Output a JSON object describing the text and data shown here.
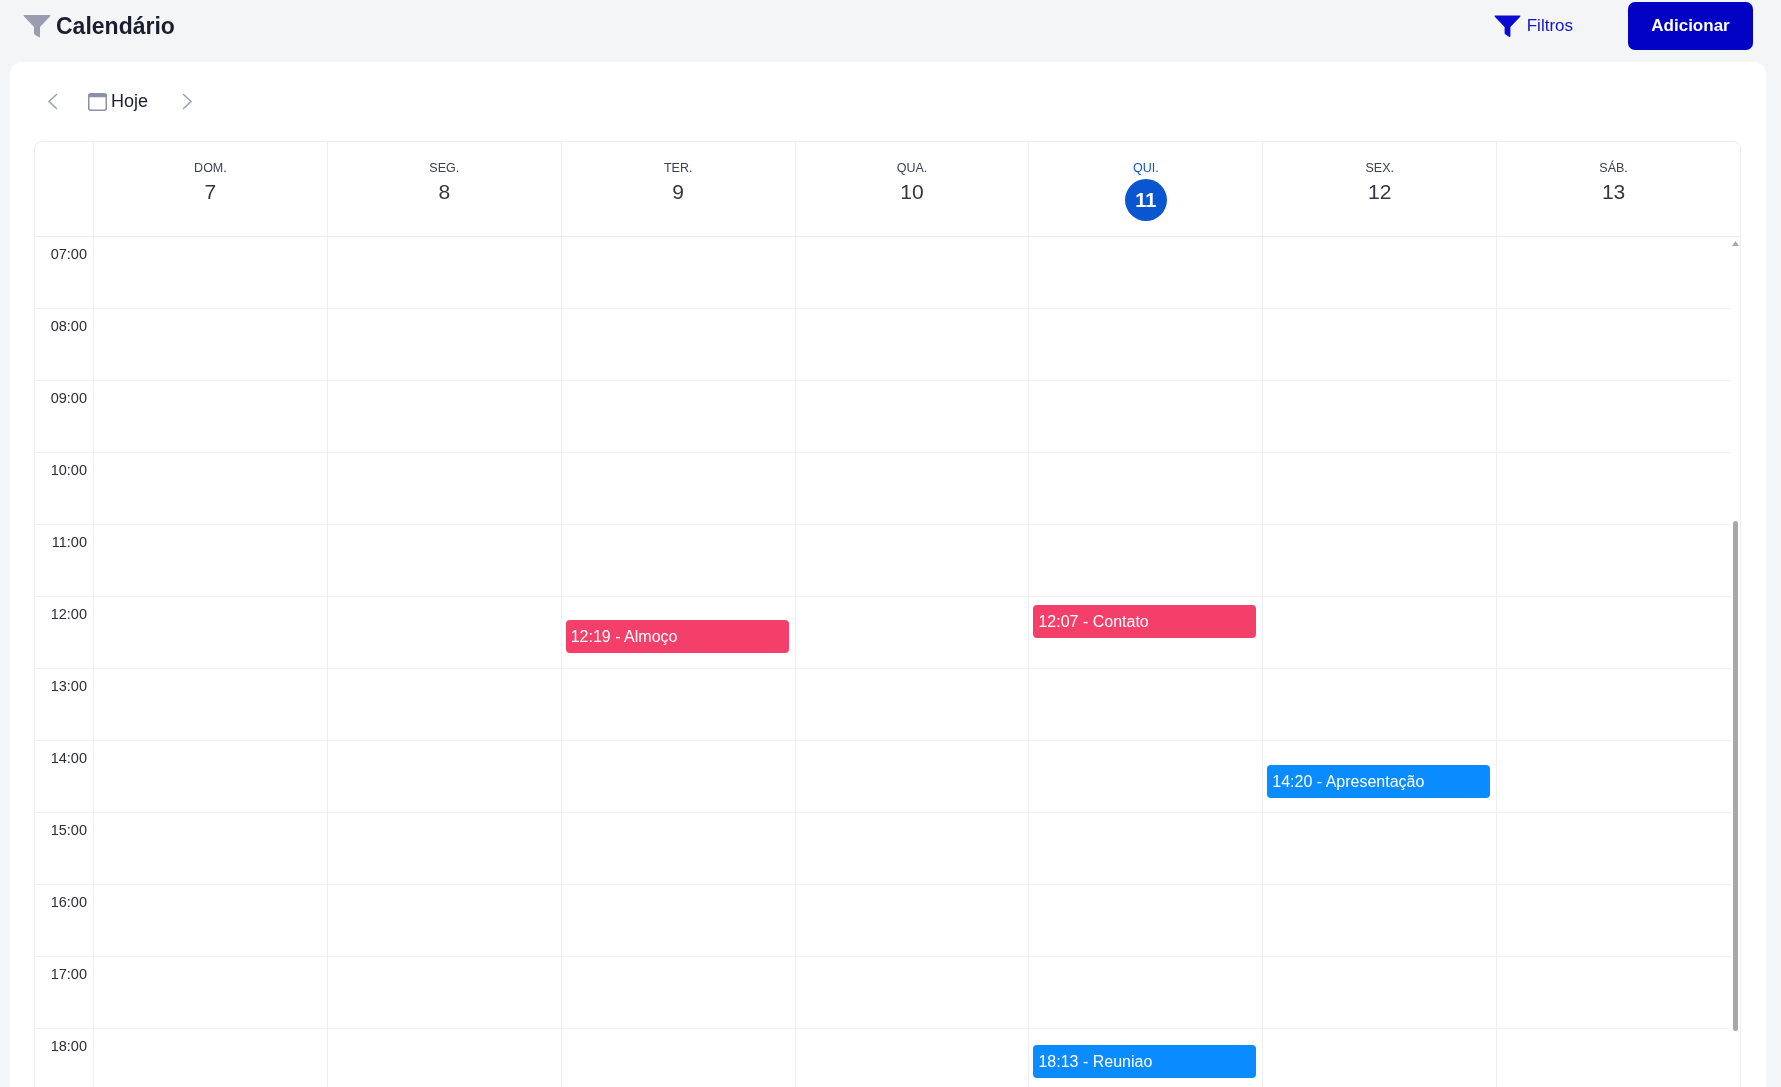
{
  "header": {
    "title": "Calendário",
    "filter_button": {
      "label": "Filtros"
    },
    "add_button": {
      "label": "Adicionar"
    }
  },
  "toolbar": {
    "today_button": {
      "label": "Hoje"
    }
  },
  "calendar": {
    "days": [
      {
        "weekday": "DOM.",
        "date": "7",
        "today": false
      },
      {
        "weekday": "SEG.",
        "date": "8",
        "today": false
      },
      {
        "weekday": "TER.",
        "date": "9",
        "today": false,
        "events": [
          {
            "time": "12:19",
            "separator": "-",
            "title": "Almoço",
            "color": "#f43f6b"
          }
        ]
      },
      {
        "weekday": "QUA.",
        "date": "10",
        "today": false
      },
      {
        "weekday": "QUI.",
        "date": "11",
        "today": true,
        "events": [
          {
            "time": "12:07",
            "separator": "-",
            "title": "Contato",
            "color": "#f43f6b"
          },
          {
            "time": "18:13",
            "separator": "-",
            "title": "Reuniao",
            "color": "#0a8bff"
          }
        ]
      },
      {
        "weekday": "SEX.",
        "date": "12",
        "today": false,
        "events": [
          {
            "time": "14:20",
            "separator": "-",
            "title": "Apresentação",
            "color": "#0a8bff"
          }
        ]
      },
      {
        "weekday": "SÁB.",
        "date": "13",
        "today": false
      }
    ],
    "hours": [
      "07:00",
      "08:00",
      "09:00",
      "10:00",
      "11:00",
      "12:00",
      "13:00",
      "14:00",
      "15:00",
      "16:00",
      "17:00",
      "18:00"
    ]
  }
}
